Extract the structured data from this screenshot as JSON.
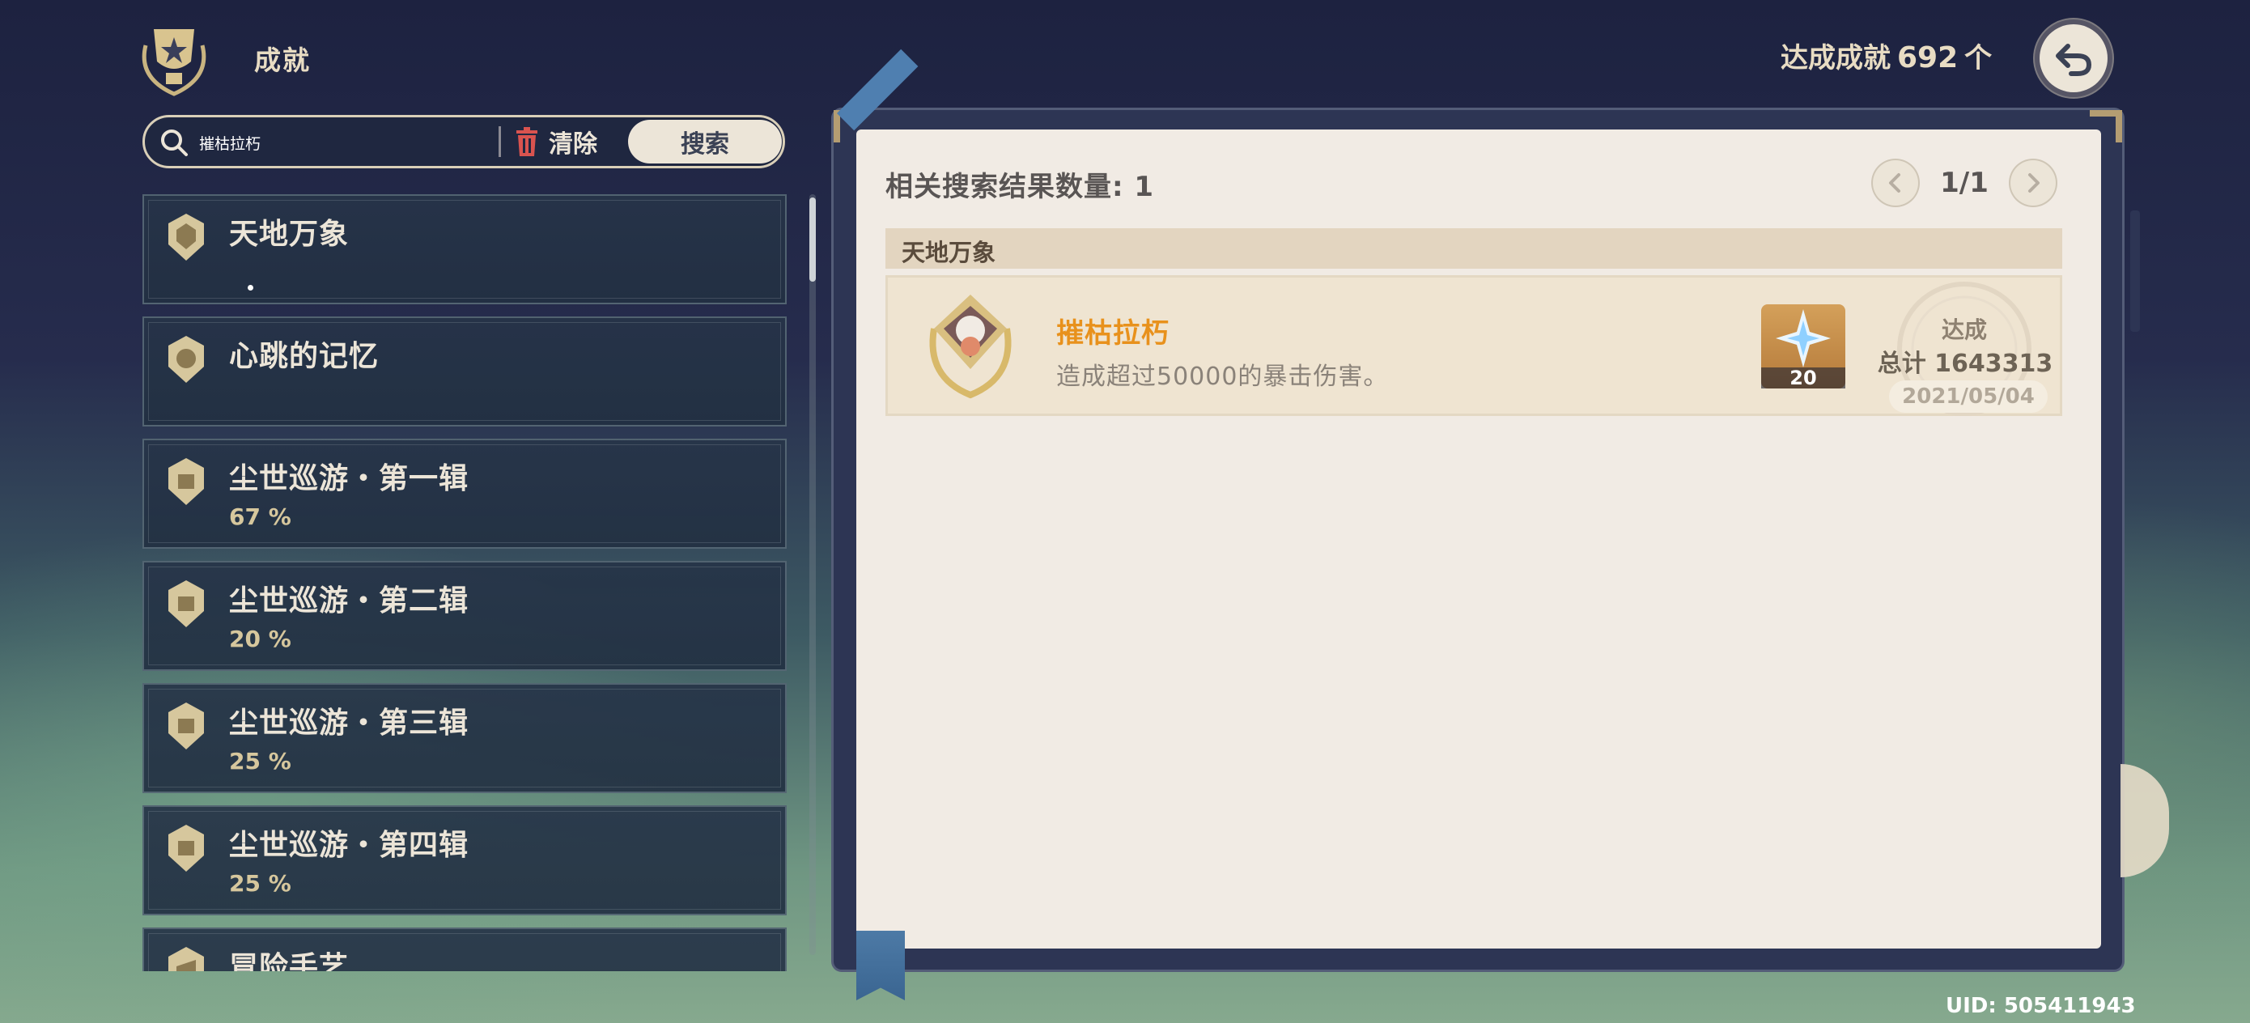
{
  "header": {
    "title": "成就",
    "total_label": "达成成就",
    "total_count": "692",
    "total_unit": "个"
  },
  "search": {
    "query": "摧枯拉朽",
    "clear_label": "清除",
    "search_label": "搜索"
  },
  "categories": [
    {
      "name": "天地万象",
      "progress": ""
    },
    {
      "name": "心跳的记忆",
      "progress": ""
    },
    {
      "name": "尘世巡游・第一辑",
      "progress": "67 %"
    },
    {
      "name": "尘世巡游・第二辑",
      "progress": "20 %"
    },
    {
      "name": "尘世巡游・第三辑",
      "progress": "25 %"
    },
    {
      "name": "尘世巡游・第四辑",
      "progress": "25 %"
    },
    {
      "name": "冒险手艺",
      "progress": ""
    }
  ],
  "results": {
    "count_label": "相关搜索结果数量: 1",
    "page_label": "1/1",
    "group_title": "天地万象",
    "achievement": {
      "name": "摧枯拉朽",
      "description": "造成超过50000的暴击伤害。",
      "reward_count": "20",
      "status": "达成",
      "total": "总计 1643313",
      "date": "2021/05/04"
    }
  },
  "footer": {
    "uid": "UID: 505411943"
  },
  "icons": {
    "trophy": "trophy-icon",
    "back": "back-arrow-icon",
    "search": "search-icon",
    "trash": "trash-icon",
    "primogem": "primogem-icon"
  },
  "colors": {
    "accent_gold": "#d6c79d",
    "achievement_name": "#e8911c",
    "panel_bg": "#f1ebe4",
    "delete_red": "#d9534f"
  }
}
